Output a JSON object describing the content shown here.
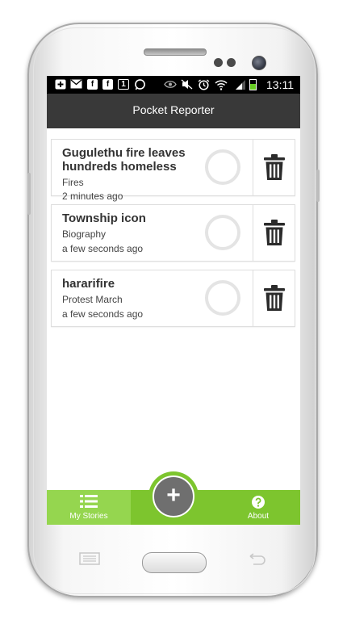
{
  "status_bar": {
    "time": "13:11",
    "icons": [
      "plus-box-icon",
      "mail-icon",
      "facebook-icon",
      "facebook-icon",
      "calendar-icon",
      "whatsapp-icon",
      "eye-icon",
      "mute-icon",
      "alarm-icon",
      "wifi-icon",
      "signal-icon",
      "battery-icon"
    ],
    "notif_fb": "f",
    "notif_cal": "1"
  },
  "app_bar": {
    "title": "Pocket Reporter"
  },
  "stories": [
    {
      "title": "Gugulethu fire leaves hundreds homeless",
      "category": "Fires",
      "time": "2 minutes ago"
    },
    {
      "title": "Township icon",
      "category": "Biography",
      "time": "a few seconds ago"
    },
    {
      "title": "hararifire",
      "category": "Protest March",
      "time": "a few seconds ago"
    }
  ],
  "bottom_nav": {
    "my_stories_label": "My Stories",
    "about_label": "About",
    "add_symbol": "+",
    "active_tab": "My Stories"
  },
  "colors": {
    "accent": "#7dc52e",
    "accent_light": "#95d64f",
    "app_bar": "#393939",
    "status_bar": "#000000"
  }
}
